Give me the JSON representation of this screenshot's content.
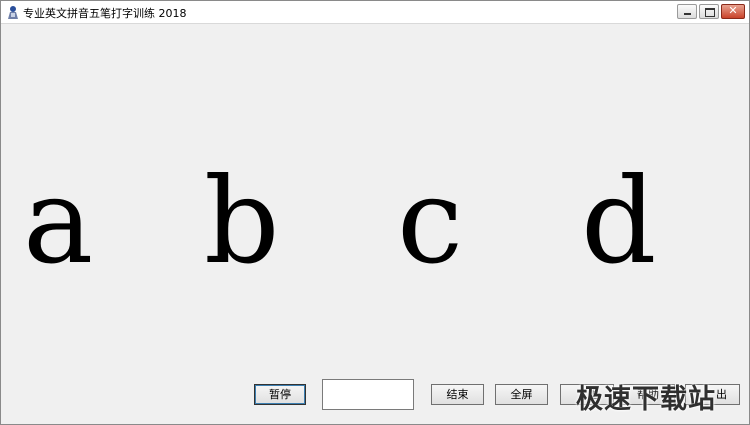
{
  "window": {
    "title": "专业英文拼音五笔打字训练 2018",
    "minimize_icon": "minimize-icon",
    "maximize_icon": "maximize-icon",
    "close_icon": "close-icon",
    "close_glyph": "✕"
  },
  "practice": {
    "letters": [
      "a",
      "b",
      "c",
      "d"
    ]
  },
  "controls": {
    "pause_label": "暂停",
    "input_value": "",
    "end_label": "结束",
    "fullscreen_label": "全屏",
    "partial_button_1_label": "退",
    "help_label": "帮助",
    "partial_button_2_label": "出"
  },
  "watermark": {
    "text": "极速下载站"
  }
}
